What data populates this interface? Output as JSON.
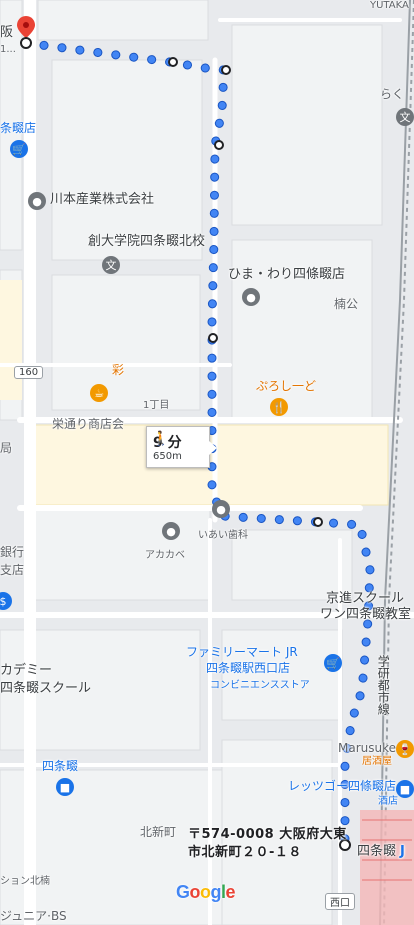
{
  "map": {
    "start_label": "阪",
    "start_sub": "1...",
    "top_right_label": "YUTAKA",
    "places": {
      "shijonawate_store": "条畷店",
      "kawamoto": "川本産業株式会社",
      "sodai_school": "創大学院四条畷北校",
      "himawari": "ひま・わり四條畷店",
      "kusunokiko": "楠公",
      "aya": "彩",
      "itchome": "1丁目",
      "eidori": "栄通り商店会",
      "purosido": "ぷろし一ど",
      "kyoku": "局",
      "ginko": "銀行",
      "shiten": "支店",
      "iai": "いあい歯科",
      "akakabe": "アカカベ",
      "kyoshin_1": "京進スクール",
      "kyoshin_2": "ワン四条畷教室",
      "famima_1": "ファミリーマート JR",
      "famima_2": "四条畷駅西口店",
      "conbini": "コンビニエンスストア",
      "academy_1": "カデミー",
      "academy_2": "四条畷スクール",
      "shijonawate_sm": "四条畷",
      "marusuke": "Marusuke",
      "izakaya": "居酒屋",
      "letsgo": "レッツゴー四條畷店",
      "sakaya": "酒店",
      "kitashinmachi": "北新町",
      "junior": "ジュニア·BS",
      "north": "ション北楠",
      "raku": "らく",
      "gakken": "学研都市線",
      "shijonawate_st": "四条畷",
      "nishiguchi": "西口",
      "route_num": "160",
      "jr": "J"
    },
    "walk": {
      "time": "9 分",
      "distance": "650m"
    },
    "destination": {
      "line1": "〒574-0008 大阪府大東",
      "line2": "市北新町２０-１８"
    },
    "logo": "Google",
    "colors": {
      "route": "#4285f4",
      "route_border": "#1a56c4",
      "pin_red": "#ea4335",
      "highlight_area": "#fef7e0",
      "station": "#f4b6b6"
    }
  }
}
